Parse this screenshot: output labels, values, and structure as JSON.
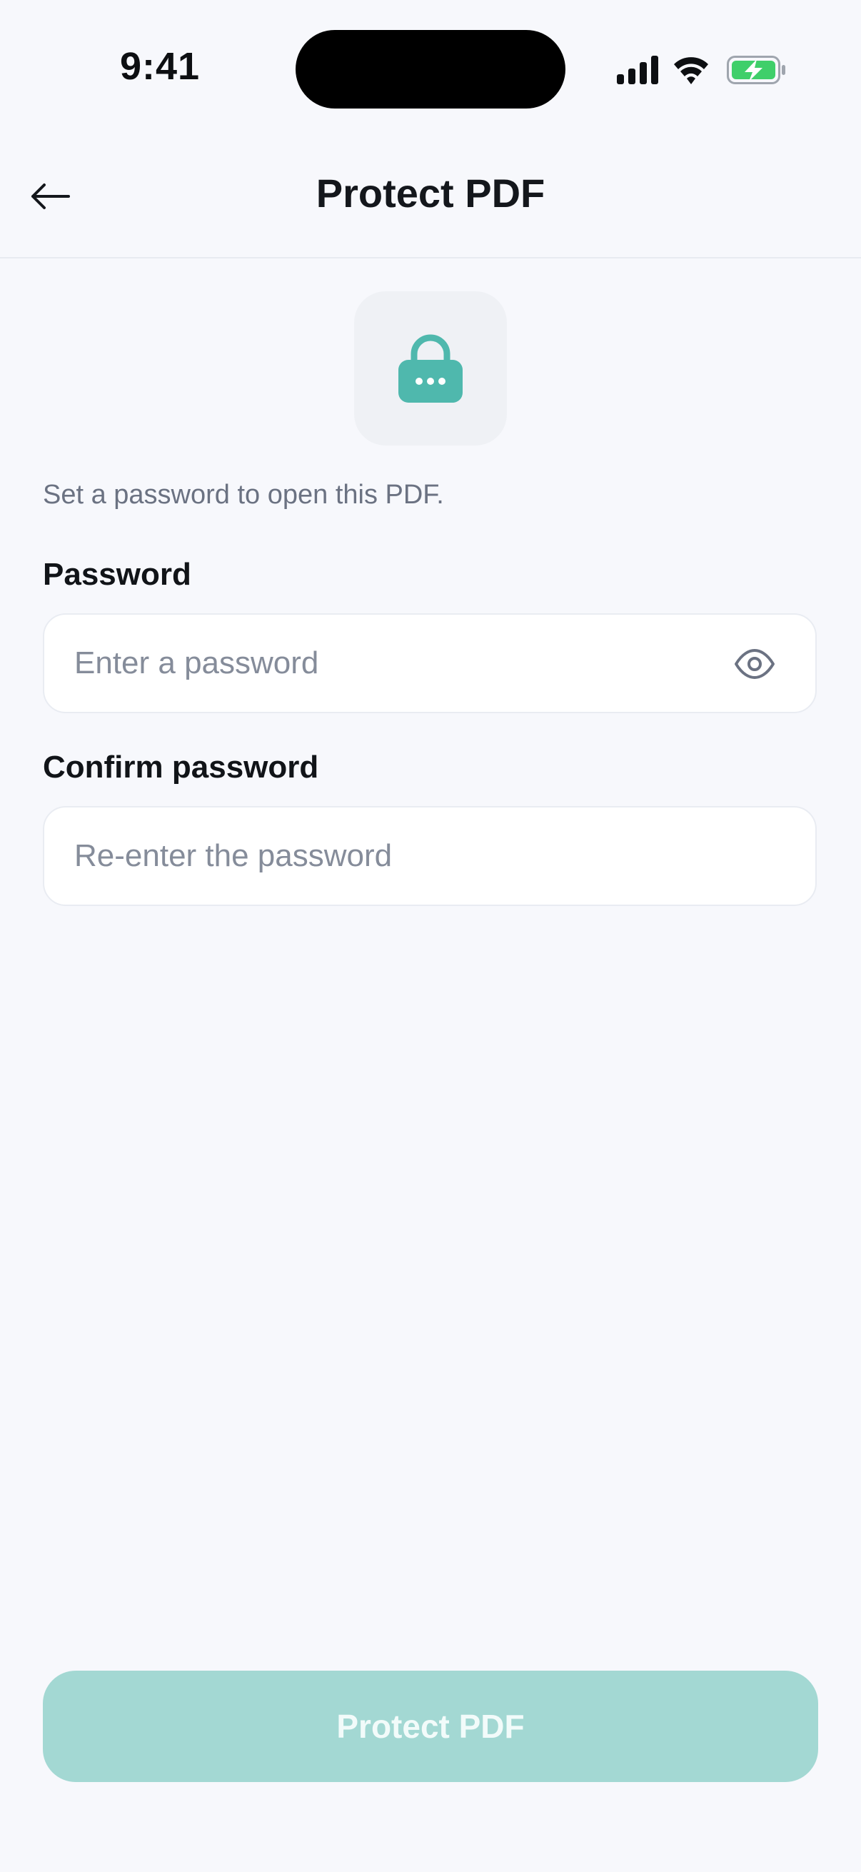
{
  "status_bar": {
    "time": "9:41"
  },
  "nav": {
    "title": "Protect PDF"
  },
  "content": {
    "helper_text": "Set a password to open this PDF.",
    "password_label": "Password",
    "password_placeholder": "Enter a password",
    "password_value": "",
    "confirm_label": "Confirm password",
    "confirm_placeholder": "Re-enter the password",
    "confirm_value": ""
  },
  "primary_button": {
    "label": "Protect PDF",
    "enabled": false
  },
  "colors": {
    "accent": "#4fb8ad",
    "accent_disabled": "#a3d8d3",
    "background": "#f7f8fc",
    "battery_green": "#3fcf6a"
  },
  "icons": {
    "back": "arrow-left-icon",
    "lock": "lock-icon",
    "eye": "eye-icon",
    "signal": "cellular-signal-icon",
    "wifi": "wifi-icon",
    "battery": "battery-charging-icon"
  }
}
